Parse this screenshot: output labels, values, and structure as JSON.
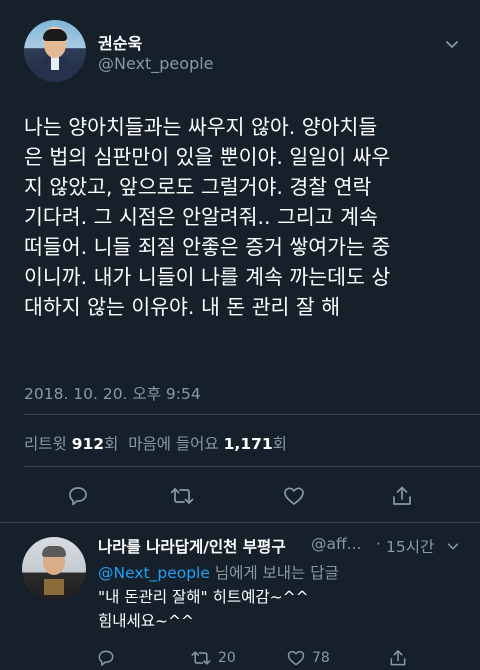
{
  "tweet": {
    "display_name": "권순욱",
    "handle": "@Next_people",
    "body_lines": [
      "나는 양아치들과는 싸우지 않아. 양아치들",
      "은 법의 심판만이 있을 뿐이야. 일일이 싸우",
      "지 않았고, 앞으로도 그럴거야. 경찰 연락",
      "기다려. 그 시점은 안알려줘.. 그리고 계속",
      "떠들어. 니들 죄질 안좋은 증거 쌓여가는 중",
      "이니까. 내가 니들이 나를 계속 까는데도 상",
      "대하지 않는 이유야. 내 돈 관리 잘 해"
    ],
    "timestamp": "2018. 10. 20. 오후 9:54",
    "retweet_label": "리트윗",
    "retweet_count": "912",
    "retweet_unit": "회",
    "like_label": "마음에 들어요",
    "like_count": "1,171",
    "like_unit": "회",
    "actions": {
      "reply_icon": "reply-icon",
      "retweet_icon": "retweet-icon",
      "like_icon": "heart-icon",
      "share_icon": "share-icon"
    }
  },
  "reply": {
    "display_name": "나라를 나라답게/인천 부평구",
    "handle": "@aff...",
    "separator": "·",
    "time": "15시간",
    "replying_to_mention": "@Next_people",
    "replying_to_suffix": " 님에게 보내는 답글",
    "text_lines": [
      "\"내 돈관리 잘해\" 히트예감~^^",
      "힘내세요~^^"
    ],
    "retweet_count": "20",
    "like_count": "78"
  },
  "colors": {
    "background": "#15202b",
    "secondary_text": "#8899a6",
    "accent": "#1da1f2",
    "divider": "#38444d"
  }
}
